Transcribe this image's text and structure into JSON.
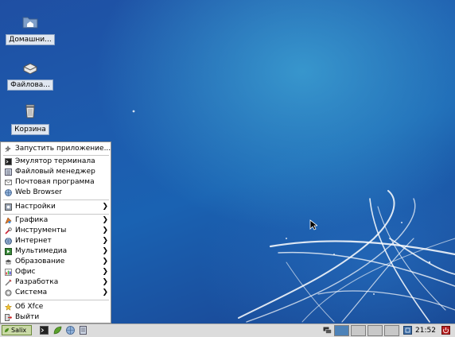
{
  "desktop": {
    "icons": [
      {
        "label": "Домашни...",
        "icon": "home-folder-icon"
      },
      {
        "label": "Файлова...",
        "icon": "file-system-icon"
      },
      {
        "label": "Корзина",
        "icon": "trash-icon"
      }
    ]
  },
  "menu": {
    "items": [
      {
        "label": "Запустить приложение...",
        "icon": "run-icon"
      },
      {
        "label": "Эмулятор терминала",
        "icon": "terminal-icon"
      },
      {
        "label": "Файловый менеджер",
        "icon": "file-manager-icon"
      },
      {
        "label": "Почтовая программа",
        "icon": "mail-icon"
      },
      {
        "label": "Web Browser",
        "icon": "globe-icon"
      },
      {
        "label": "Настройки",
        "icon": "settings-icon",
        "submenu": true
      },
      {
        "label": "Графика",
        "icon": "graphics-icon",
        "submenu": true
      },
      {
        "label": "Инструменты",
        "icon": "tools-icon",
        "submenu": true
      },
      {
        "label": "Интернет",
        "icon": "internet-icon",
        "submenu": true
      },
      {
        "label": "Мультимедиа",
        "icon": "multimedia-icon",
        "submenu": true
      },
      {
        "label": "Образование",
        "icon": "education-icon",
        "submenu": true
      },
      {
        "label": "Офис",
        "icon": "office-icon",
        "submenu": true
      },
      {
        "label": "Разработка",
        "icon": "development-icon",
        "submenu": true
      },
      {
        "label": "Система",
        "icon": "system-icon",
        "submenu": true
      },
      {
        "label": "Об Xfce",
        "icon": "star-icon"
      },
      {
        "label": "Выйти",
        "icon": "logout-icon"
      }
    ]
  },
  "taskbar": {
    "start_label": "Salix",
    "clock": "21:52",
    "launchers": [
      "terminal-icon",
      "leaf-icon",
      "globe-icon",
      "file-manager-icon"
    ],
    "tray": [
      "network-icon",
      "keyboard-layout-icon",
      "power-icon"
    ]
  }
}
